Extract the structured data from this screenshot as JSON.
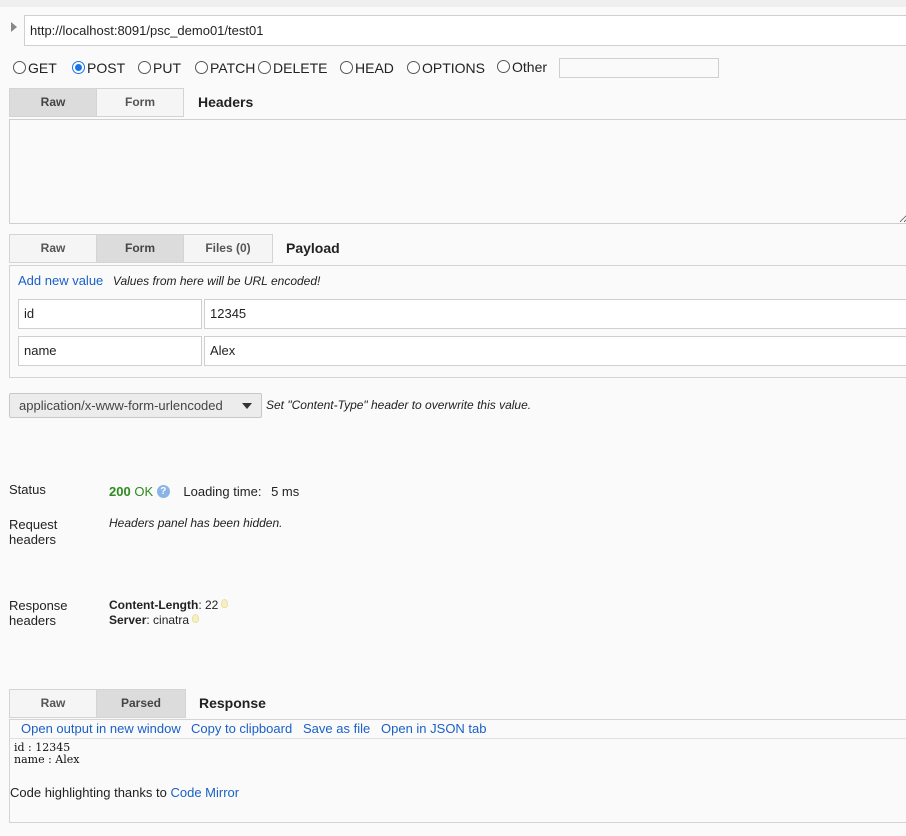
{
  "request": {
    "url": "http://localhost:8091/psc_demo01/test01",
    "methods": [
      {
        "label": "GET",
        "selected": false
      },
      {
        "label": "POST",
        "selected": true
      },
      {
        "label": "PUT",
        "selected": false
      },
      {
        "label": "PATCH",
        "selected": false
      },
      {
        "label": "DELETE",
        "selected": false
      },
      {
        "label": "HEAD",
        "selected": false
      },
      {
        "label": "OPTIONS",
        "selected": false
      },
      {
        "label": "Other",
        "selected": false
      }
    ],
    "other_method_value": ""
  },
  "headers_section": {
    "tabs": [
      "Raw",
      "Form"
    ],
    "active_tab": "Raw",
    "title": "Headers",
    "raw_value": ""
  },
  "payload_section": {
    "tabs": [
      "Raw",
      "Form",
      "Files (0)"
    ],
    "active_tab": "Form",
    "title": "Payload",
    "add_value_link": "Add new value",
    "encoding_note": "Values from here will be URL encoded!",
    "fields": [
      {
        "name": "id",
        "value": "12345"
      },
      {
        "name": "name",
        "value": "Alex"
      }
    ],
    "content_type": "application/x-www-form-urlencoded",
    "content_type_note": "Set \"Content-Type\" header to overwrite this value."
  },
  "result": {
    "status_label": "Status",
    "status_code": "200",
    "status_text": "OK",
    "loading_label": "Loading time:",
    "loading_value": "5 ms",
    "request_headers_label_1": "Request",
    "request_headers_label_2": "headers",
    "request_headers_note": "Headers panel has been hidden.",
    "response_headers_label_1": "Response",
    "response_headers_label_2": "headers",
    "response_headers": [
      {
        "name": "Content-Length",
        "value": "22"
      },
      {
        "name": "Server",
        "value": "cinatra"
      }
    ]
  },
  "response_section": {
    "tabs": [
      "Raw",
      "Parsed"
    ],
    "active_tab": "Parsed",
    "title": "Response",
    "actions": [
      "Open output in new window",
      "Copy to clipboard",
      "Save as file",
      "Open in JSON tab"
    ],
    "body_lines": [
      "id : 12345",
      "name : Alex"
    ],
    "credit_text": "Code highlighting thanks to",
    "credit_link": "Code Mirror"
  },
  "colors": {
    "link": "#1a60c8",
    "status_ok": "#2e8b1f",
    "radio_selected": "#1a73e8"
  }
}
